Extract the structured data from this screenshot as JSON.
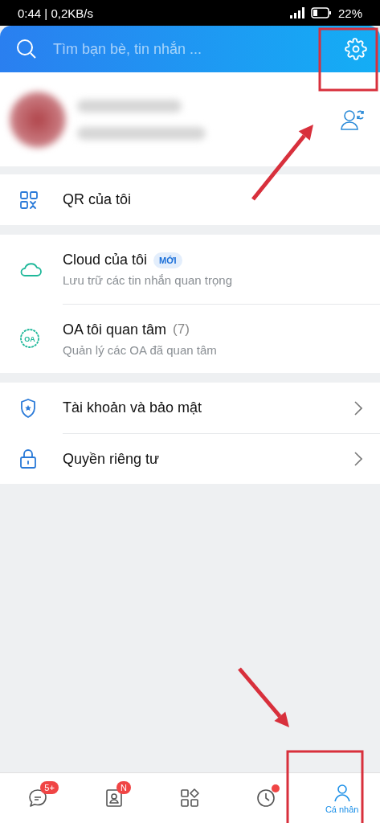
{
  "status_bar": {
    "time": "0:44 | 0,2KB/s",
    "battery": "22%"
  },
  "search": {
    "placeholder": "Tìm bạn bè, tin nhắn ..."
  },
  "profile": {
    "kind": "blurred"
  },
  "menu_groups": [
    [
      {
        "title": "QR của tôi",
        "chevron": false
      }
    ],
    [
      {
        "title": "Cloud của tôi",
        "badge": "MỚI",
        "subtitle": "Lưu trữ các tin nhắn quan trọng",
        "chevron": false
      },
      {
        "icon_label": "OA",
        "title": "OA tôi quan tâm",
        "count": "(7)",
        "subtitle": "Quản lý các OA đã quan tâm",
        "chevron": false
      }
    ],
    [
      {
        "title": "Tài khoản và bảo mật",
        "chevron": true
      },
      {
        "title": "Quyền riêng tư",
        "chevron": true
      }
    ]
  ],
  "bottom_nav": [
    {
      "badge": "5+",
      "selected": false
    },
    {
      "badge": "N",
      "selected": false
    },
    {
      "selected": false
    },
    {
      "dot": true,
      "selected": false
    },
    {
      "label": "Cá nhân",
      "selected": true
    }
  ],
  "annotations": [
    {
      "kind": "box"
    },
    {
      "kind": "arrow"
    },
    {
      "kind": "arrow"
    },
    {
      "kind": "box"
    }
  ]
}
